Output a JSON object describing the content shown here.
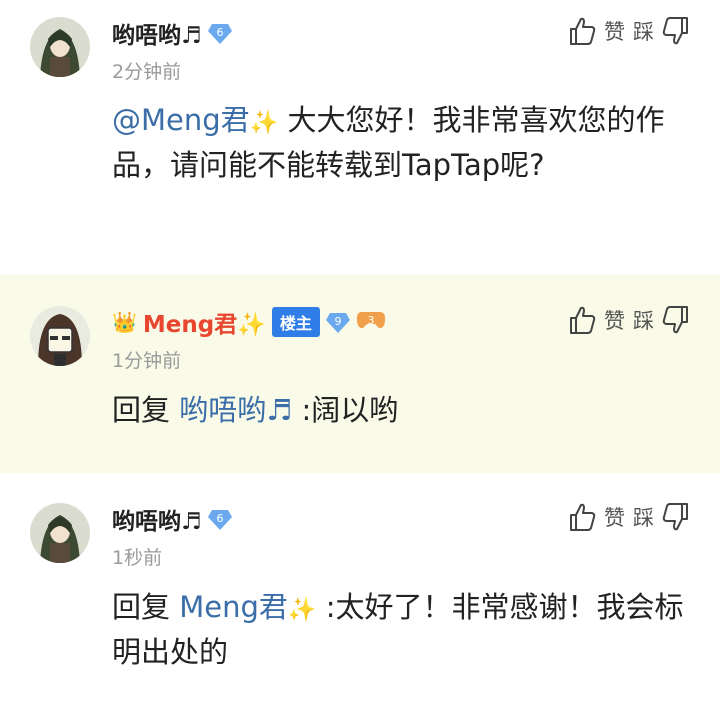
{
  "comments": [
    {
      "username": "哟唔哟♬",
      "level": "6",
      "time": "2分钟前",
      "mention": "@Meng君",
      "text": "大大您好！我非常喜欢您的作品，请问能不能转载到TapTap呢?"
    },
    {
      "username": "Meng君",
      "owner_tag": "楼主",
      "level": "9",
      "game_badge": "3",
      "time": "1分钟前",
      "reply_prefix": "回复",
      "mention": "哟唔哟♬",
      "text": ":阔以哟"
    },
    {
      "username": "哟唔哟♬",
      "level": "6",
      "time": "1秒前",
      "reply_prefix": "回复",
      "mention": "Meng君",
      "text": ":太好了！非常感谢！我会标明出处的"
    }
  ],
  "actions": {
    "like_label": "赞",
    "dislike_label": "踩"
  },
  "colors": {
    "mention": "#3b6ea8",
    "op_name": "#e8462e",
    "reply_bg": "#fafae9",
    "owner_tag": "#2f7ee8"
  }
}
